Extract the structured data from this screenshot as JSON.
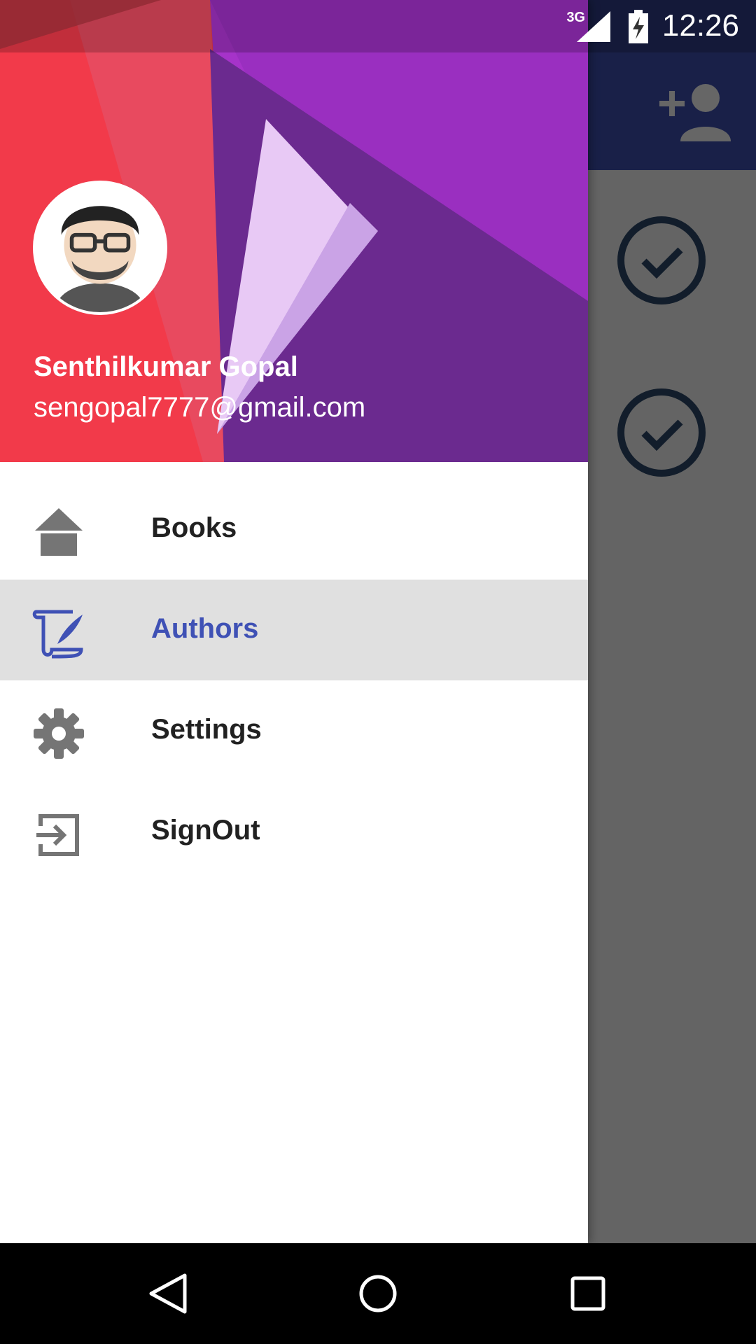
{
  "status_bar": {
    "time": "12:26",
    "network": "3G",
    "icons": [
      "signal-icon",
      "battery-charging-icon"
    ]
  },
  "toolbar": {
    "action_icon": "add-person-icon",
    "color": "#3f51b5"
  },
  "drawer": {
    "user": {
      "name": "Senthilkumar Gopal",
      "email": "sengopal7777@gmail.com",
      "avatar_icon": "avatar-icon"
    },
    "items": [
      {
        "label": "Books",
        "icon": "home-icon",
        "selected": false
      },
      {
        "label": "Authors",
        "icon": "quill-scroll-icon",
        "selected": true
      },
      {
        "label": "Settings",
        "icon": "gear-icon",
        "selected": false
      },
      {
        "label": "SignOut",
        "icon": "sign-out-icon",
        "selected": false
      }
    ],
    "accent_color": "#3f51b5",
    "selected_bg": "#e0e0e0"
  },
  "background_list": {
    "icons": [
      "check-circle-icon",
      "check-circle-icon"
    ]
  },
  "nav_bar": {
    "icons": [
      "back-icon",
      "home-circle-icon",
      "recents-icon"
    ]
  }
}
